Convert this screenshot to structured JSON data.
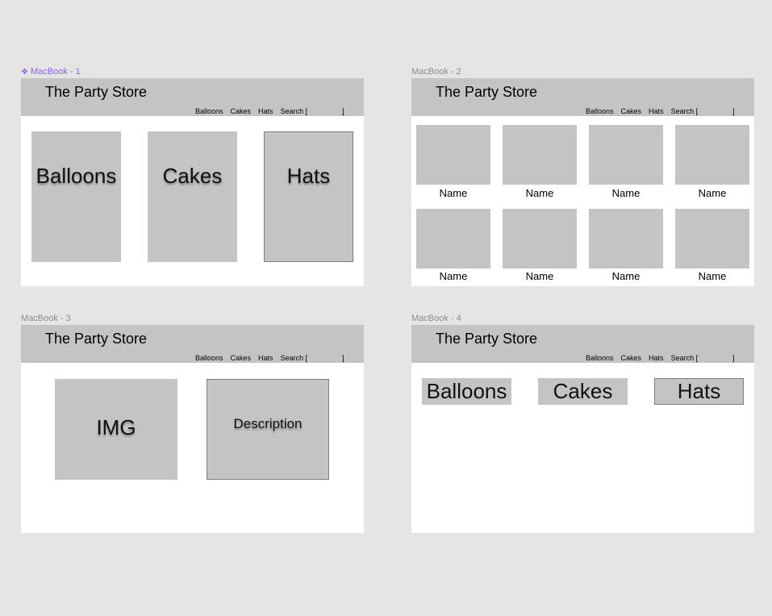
{
  "frames": [
    {
      "label": "MacBook - 1",
      "component_icon": "❖"
    },
    {
      "label": "MacBook - 2"
    },
    {
      "label": "MacBook - 3"
    },
    {
      "label": "MacBook - 4"
    }
  ],
  "header": {
    "store_title": "The Party Store",
    "nav": [
      "Balloons",
      "Cakes",
      "Hats"
    ],
    "search_label": "Search [",
    "search_close": "]"
  },
  "frame1": {
    "tiles": [
      "Balloons",
      "Cakes",
      "Hats"
    ]
  },
  "frame2": {
    "product_name": "Name"
  },
  "frame3": {
    "image_label": "IMG",
    "description_label": "Description"
  },
  "frame4": {
    "buttons": [
      "Balloons",
      "Cakes",
      "Hats"
    ]
  },
  "colors": {
    "canvas": "#e5e5e5",
    "frame": "#ffffff",
    "placeholder": "#c4c4c4",
    "selected_label": "#8b5cf6"
  }
}
